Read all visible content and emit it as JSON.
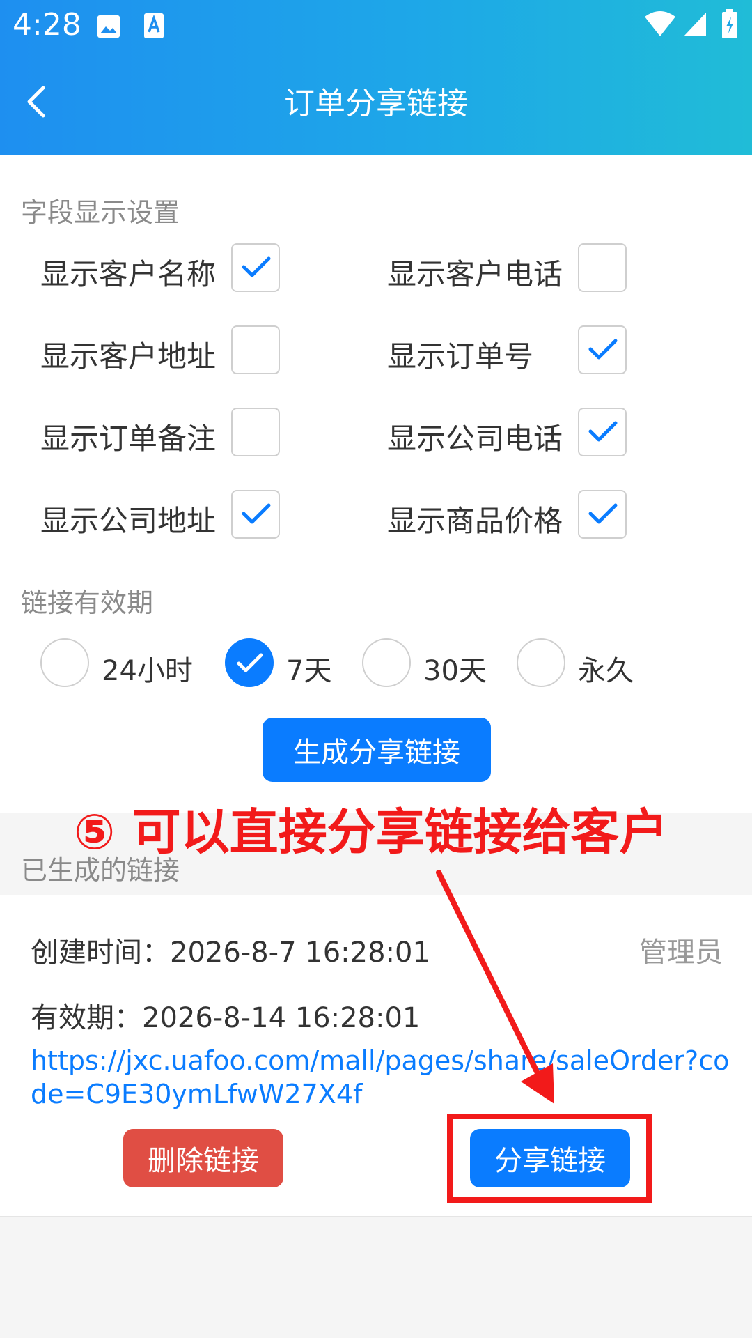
{
  "status_bar": {
    "time": "4:28",
    "icons": [
      "image-icon",
      "text-a-icon",
      "wifi-icon",
      "signal-icon",
      "battery-icon"
    ]
  },
  "header": {
    "title": "订单分享链接",
    "back_icon": "chevron-left-icon"
  },
  "field_settings": {
    "section_label": "字段显示设置",
    "fields": [
      {
        "label": "显示客户名称",
        "checked": true
      },
      {
        "label": "显示客户电话",
        "checked": false
      },
      {
        "label": "显示客户地址",
        "checked": false
      },
      {
        "label": "显示订单号",
        "checked": true
      },
      {
        "label": "显示订单备注",
        "checked": false
      },
      {
        "label": "显示公司电话",
        "checked": true
      },
      {
        "label": "显示公司地址",
        "checked": true
      },
      {
        "label": "显示商品价格",
        "checked": true
      }
    ]
  },
  "validity": {
    "section_label": "链接有效期",
    "options": [
      {
        "label": "24小时",
        "selected": false
      },
      {
        "label": "7天",
        "selected": true
      },
      {
        "label": "30天",
        "selected": false
      },
      {
        "label": "永久",
        "selected": false
      }
    ]
  },
  "generate_button_label": "生成分享链接",
  "generated": {
    "section_label": "已生成的链接",
    "items": [
      {
        "created_label": "创建时间：",
        "created_value": "2026-8-7 16:28:01",
        "creator": "管理员",
        "expiry_label": "有效期：",
        "expiry_value": "2026-8-14 16:28:01",
        "url_line1": "https://jxc.uafoo.com/mall/pages/share/saleOrder?co",
        "url_line2": "de=C9E30ymLfwW27X4f",
        "delete_label": "删除链接",
        "share_label": "分享链接"
      }
    ]
  },
  "annotation": {
    "text": "⑤ 可以直接分享链接给客户",
    "color": "#f21a1a"
  },
  "colors": {
    "primary": "#0a7cff",
    "danger": "#e04e44",
    "header_start": "#1e8ff0",
    "header_end": "#20bcd7"
  }
}
